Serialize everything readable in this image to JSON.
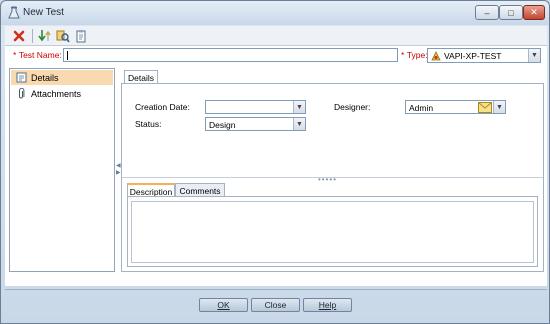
{
  "window": {
    "title": "New Test",
    "minimize": "–",
    "maximize": "□",
    "close": "✕"
  },
  "toolbar": {
    "icons": [
      "delete-icon",
      "move-down-icon",
      "find-icon",
      "clipboard-icon"
    ]
  },
  "form": {
    "name_label": "Test Name:",
    "name_value": "",
    "type_label": "Type:",
    "type_value": "VAPI-XP-TEST",
    "required_marker": "*"
  },
  "sidebar": {
    "items": [
      {
        "label": "Details",
        "icon": "details-icon",
        "active": true
      },
      {
        "label": "Attachments",
        "icon": "paperclip-icon",
        "active": false
      }
    ]
  },
  "details": {
    "tab_label": "Details",
    "creation_date_label": "Creation Date:",
    "creation_date_value": "",
    "status_label": "Status:",
    "status_value": "Design",
    "designer_label": "Designer:",
    "designer_value": "Admin",
    "divider_dots": "•••••"
  },
  "description": {
    "tabs": [
      "Description",
      "Comments"
    ],
    "active_tab": "Description"
  },
  "buttons": {
    "ok": "OK",
    "close": "Close",
    "help": "Help"
  },
  "colors": {
    "accent_tab": "#f2b15a",
    "active_item": "#f8d9b0",
    "required_red": "#cc0000"
  }
}
